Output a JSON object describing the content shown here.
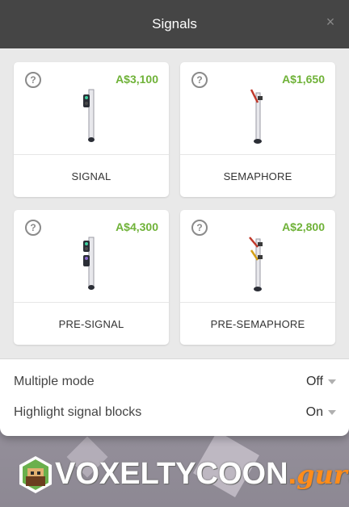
{
  "dialog": {
    "title": "Signals",
    "close_glyph": "×"
  },
  "cards": [
    {
      "price": "A$3,100",
      "label": "SIGNAL",
      "help_glyph": "?",
      "icon": "signal-light-icon"
    },
    {
      "price": "A$1,650",
      "label": "SEMAPHORE",
      "help_glyph": "?",
      "icon": "semaphore-icon"
    },
    {
      "price": "A$4,300",
      "label": "PRE-SIGNAL",
      "help_glyph": "?",
      "icon": "pre-signal-light-icon"
    },
    {
      "price": "A$2,800",
      "label": "PRE-SEMAPHORE",
      "help_glyph": "?",
      "icon": "pre-semaphore-icon"
    }
  ],
  "settings": {
    "multiple_mode": {
      "label": "Multiple mode",
      "value": "Off"
    },
    "highlight_blocks": {
      "label": "Highlight signal blocks",
      "value": "On"
    }
  },
  "watermark": {
    "brand": "VOXELTYCOON",
    "dot": ".",
    "suffix": "guru"
  },
  "colors": {
    "price_green": "#6fb238",
    "titlebar": "#454545",
    "accent_orange": "#ff8c1a"
  }
}
